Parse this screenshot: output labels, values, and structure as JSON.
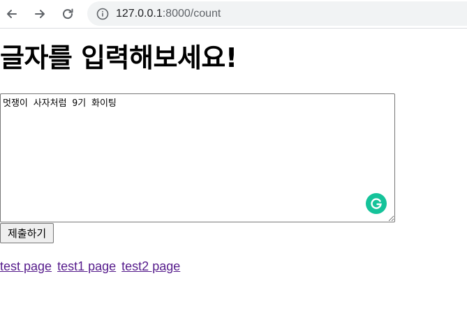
{
  "browser": {
    "url_host": "127.0.0.1",
    "url_path": ":8000/count",
    "icons": [
      "back-arrow-icon",
      "forward-arrow-icon",
      "reload-icon",
      "info-icon"
    ]
  },
  "page": {
    "heading": "글자를 입력해보세요!",
    "textarea_value": "멋쟁이 사자처럼 9기 화이팅",
    "submit_label": "제출하기",
    "links": [
      {
        "label": "test page"
      },
      {
        "label": "test1 page"
      },
      {
        "label": "test2 page"
      }
    ],
    "link_color": "#551a8b",
    "grammarly_color": "#15c39a"
  }
}
